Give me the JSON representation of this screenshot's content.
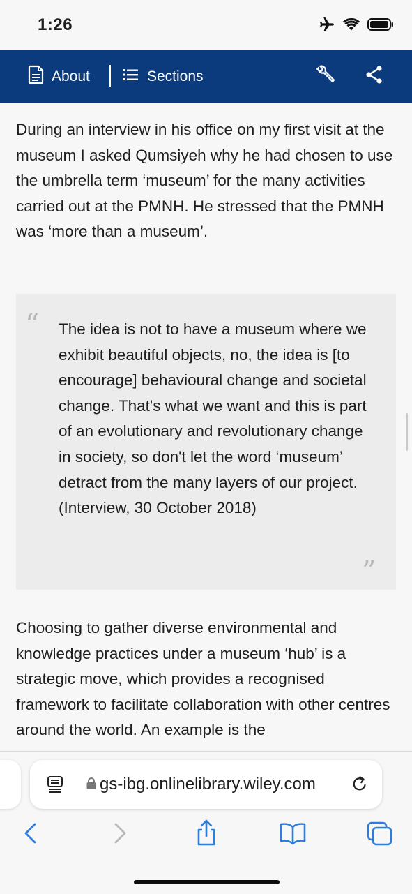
{
  "status_bar": {
    "time": "1:26"
  },
  "header": {
    "about_label": "About",
    "sections_label": "Sections"
  },
  "article": {
    "paragraph1": "During an interview in his office on my first visit at the museum I asked Qumsiyeh why he had chosen to use the umbrella term ‘museum’ for the many activities carried out at the PMNH. He stressed that the PMNH was ‘more than a museum’.",
    "quote": "The idea is not to have a museum where we exhibit beautiful objects, no, the idea is [to encourage] behavioural change and societal change. That's what we want and this is part of an evolutionary and revolutionary change in society, so don't let the word ‘museum’ detract from the many layers of our project. (Interview, 30 October 2018)",
    "paragraph2": "Choosing to gather diverse environmental and knowledge practices under a museum ‘hub’ is a strategic move, which provides a recognised framework to facilitate collaboration with other centres around the world. An example is the"
  },
  "browser": {
    "url": "gs-ibg.onlinelibrary.wiley.com"
  },
  "colors": {
    "header_bg": "#0b3b7c",
    "accent_blue": "#2f7ddb",
    "quote_bg": "#ececec"
  }
}
